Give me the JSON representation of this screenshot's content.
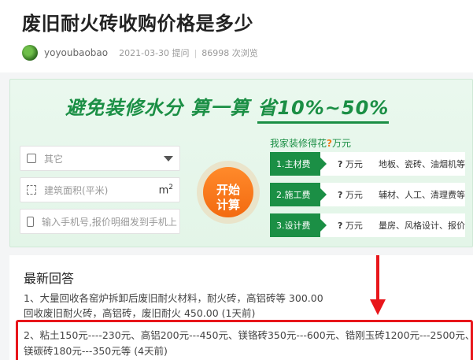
{
  "question": {
    "title": "废旧耐火砖收购价格是多少",
    "username": "yoyoubaobao",
    "date_asked": "2021-03-30 提问",
    "views": "86998 次浏览"
  },
  "ad": {
    "slogan": "避免装修水分 算一算",
    "slogan_highlight": "省10%~50%",
    "type_select": "其它",
    "area_placeholder": "建筑面积(平米)",
    "area_unit": "m",
    "area_unit_sup": "2",
    "phone_placeholder": "输入手机号,报价明细发到手机上",
    "calc_line1": "开始",
    "calc_line2": "计算",
    "ask_prefix": "我家装修得花",
    "ask_q": "?",
    "ask_suffix": "万元",
    "rows": [
      {
        "tag": "1.主材费",
        "q": "?",
        "unit": "万元",
        "items": "地板、瓷砖、油烟机等"
      },
      {
        "tag": "2.施工费",
        "q": "?",
        "unit": "万元",
        "items": "辅材、人工、清理费等"
      },
      {
        "tag": "3.设计费",
        "q": "?",
        "unit": "万元",
        "items": "量房、风格设计、报价"
      }
    ]
  },
  "answers": {
    "heading": "最新回答",
    "items": [
      {
        "line1": "1、大量回收各窑炉拆卸后废旧耐火材料，耐火砖，高铝砖等    300.00",
        "line2": "回收废旧耐火砖，高铝砖，废旧耐火    450.00 (1天前)"
      },
      {
        "line1": "2、粘土150元----230元、高铝200元---450元、镁铬砖350元---600元、锆刚玉砖1200元---2500元、",
        "line2": "镁碳砖180元---350元等 (4天前)"
      }
    ]
  },
  "colors": {
    "brand_green": "#1b8f45",
    "accent_orange": "#f36a10",
    "highlight_red": "#e8161b"
  },
  "icons": [
    "building-icon",
    "dropdown-caret-icon",
    "area-icon",
    "phone-icon",
    "down-arrow-annotation-icon"
  ]
}
